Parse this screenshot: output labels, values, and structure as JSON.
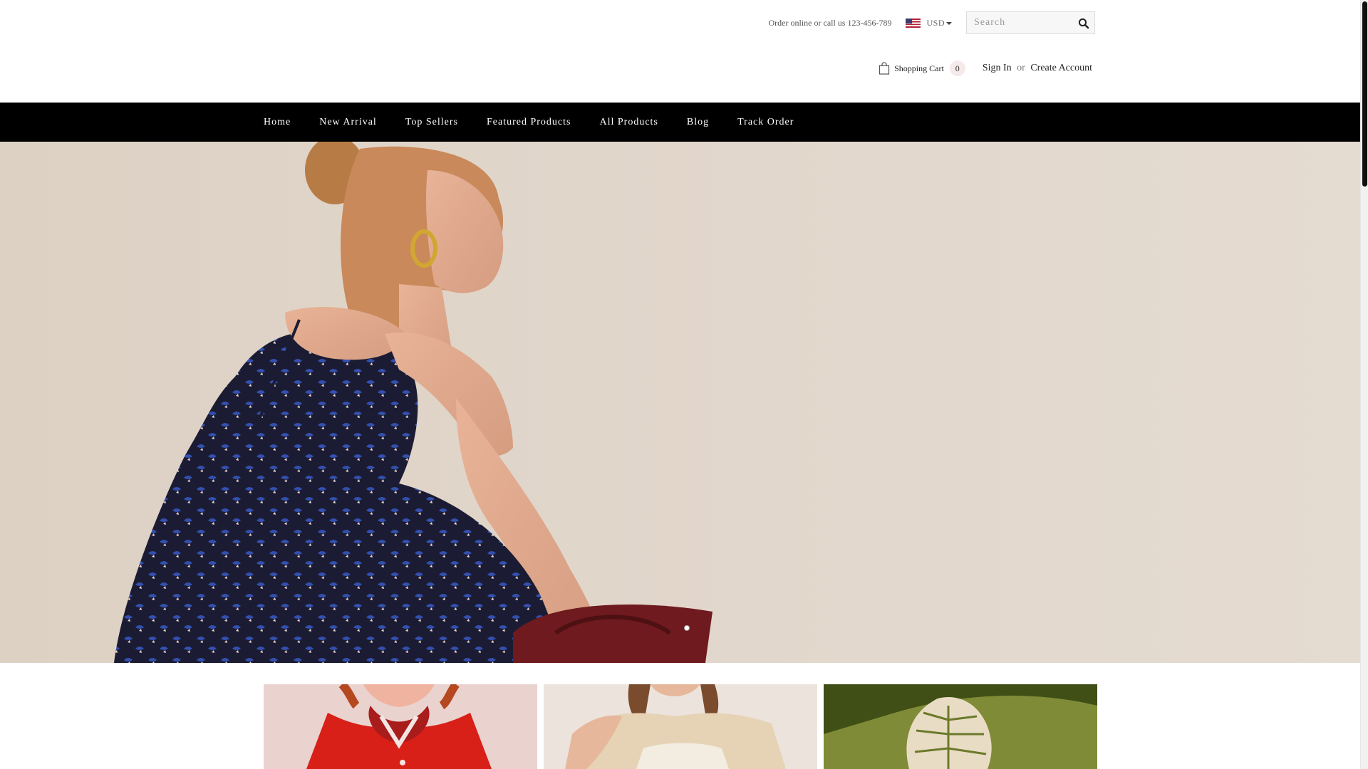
{
  "topbar": {
    "order_text": "Order online or call us 123-456-789",
    "currency": {
      "selected": "USD",
      "flag_icon": "us-flag-icon"
    },
    "search": {
      "placeholder": "Search",
      "value": "",
      "icon": "search-icon"
    }
  },
  "account": {
    "cart_label": "Shopping Cart",
    "cart_count": "0",
    "sign_in": "Sign In",
    "or": "or",
    "create_account": "Create Account"
  },
  "nav": {
    "items": [
      {
        "label": "Home"
      },
      {
        "label": "New Arrival"
      },
      {
        "label": "Top Sellers"
      },
      {
        "label": "Featured Products"
      },
      {
        "label": "All Products"
      },
      {
        "label": "Blog"
      },
      {
        "label": "Track Order"
      }
    ]
  },
  "hero": {
    "slide_count": 1,
    "active_slide": 1
  },
  "colors": {
    "nav_bg": "#000000",
    "nav_text": "#ffffff",
    "hero_bg": "#e2d7cc",
    "cart_badge_bg": "#f6e9e9"
  }
}
